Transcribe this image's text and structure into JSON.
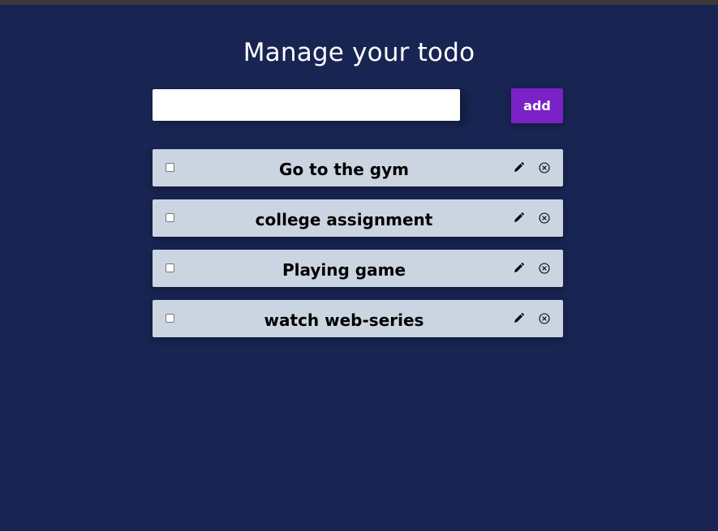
{
  "header": {
    "title": "Manage your todo"
  },
  "form": {
    "input_value": "",
    "input_placeholder": "",
    "add_label": "add"
  },
  "todos": [
    {
      "label": "Go to the gym",
      "checked": false,
      "edit_icon": "pencil-icon",
      "delete_icon": "close-circle-icon"
    },
    {
      "label": "college assignment",
      "checked": false,
      "edit_icon": "pencil-icon",
      "delete_icon": "close-circle-icon"
    },
    {
      "label": "Playing game",
      "checked": false,
      "edit_icon": "pencil-icon",
      "delete_icon": "close-circle-icon"
    },
    {
      "label": "watch web-series",
      "checked": false,
      "edit_icon": "pencil-icon",
      "delete_icon": "close-circle-icon"
    }
  ],
  "colors": {
    "background": "#182452",
    "accent": "#7a22c8",
    "item_background": "#cbd5e2"
  }
}
